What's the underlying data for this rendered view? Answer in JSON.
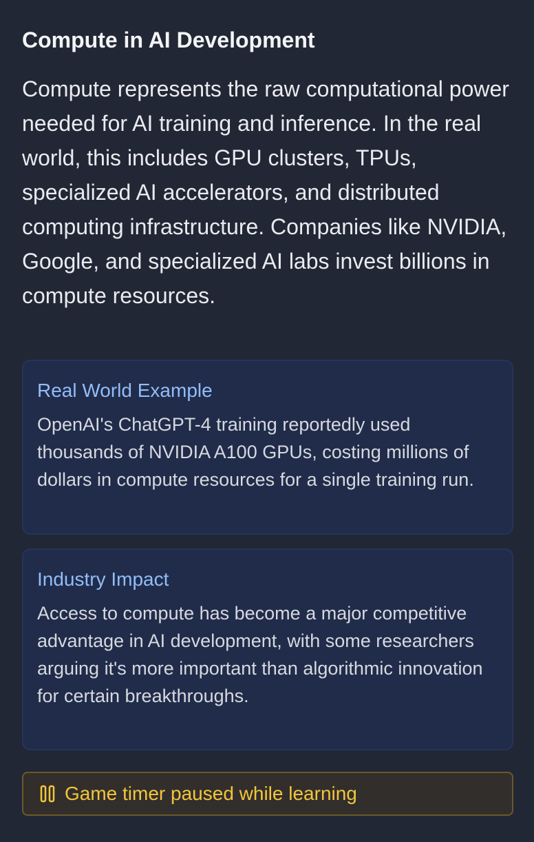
{
  "section": {
    "title": "Compute in AI Development",
    "description": "Compute represents the raw computational power needed for AI training and inference. In the real world, this includes GPU clusters, TPUs, specialized AI accelerators, and distributed computing infrastructure. Companies like NVIDIA, Google, and specialized AI labs invest billions in compute resources."
  },
  "cards": [
    {
      "title": "Real World Example",
      "body": "OpenAI's ChatGPT-4 training reportedly used thousands of NVIDIA A100 GPUs, costing millions of dollars in compute resources for a single training run."
    },
    {
      "title": "Industry Impact",
      "body": "Access to compute has become a major competitive advantage in AI development, with some researchers arguing it's more important than algorithmic innovation for certain breakthroughs."
    }
  ],
  "timer": {
    "icon": "pause-icon",
    "text": "Game timer paused while learning"
  },
  "colors": {
    "background": "#222735",
    "card_background": "#212c4a",
    "card_title": "#92bdf9",
    "timer_text": "#f2c63c",
    "timer_border": "#6a5a2a"
  }
}
